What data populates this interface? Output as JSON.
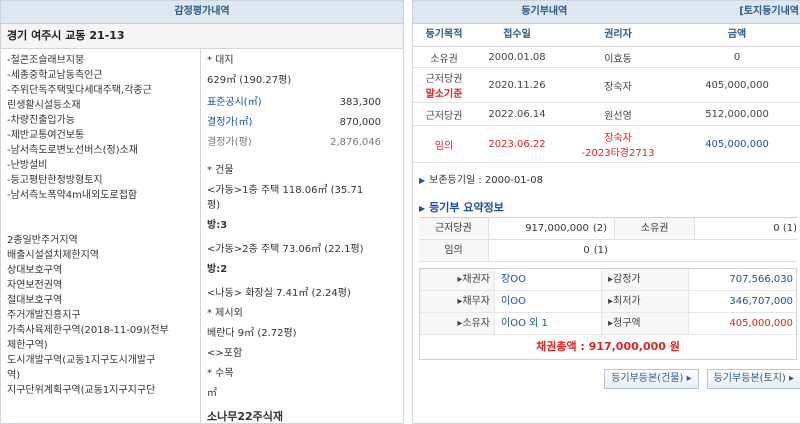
{
  "left": {
    "title": "감정평가내역",
    "address": "경기 여주시 교동 21-13",
    "features": [
      "-철콘조슬래브지붕",
      "-세종중학교남동측인근",
      "-주위단독주택및다세대주택,각종근",
      "린생활시설등소재",
      "-차량진출입가능",
      "-제반교통여건보통",
      "-남서측도로변노선버스(정)소재",
      "-난방설비",
      "-등고평탄한정방형토지",
      "-남서측노폭약4m내외도로접함"
    ],
    "zoning": [
      "2종일반주거지역",
      "배출시설설치제한지역",
      "상대보호구역",
      "자연보전권역",
      "절대보호구역",
      "주거개발진흥지구",
      "가축사육제한구역(2018-11-09)(전부",
      "제한구역)",
      "도시개발구역(교동1지구도시개발구",
      "역)",
      "지구단위계획구역(교동1지구지구단"
    ],
    "land_heading": "* 대지",
    "land_area": "629㎡  (190.27평)",
    "official_price_label": "표준공시(㎡)",
    "official_price_value": "383,300",
    "decided_price_label": "결정가(㎡)",
    "decided_price_value": "870,000",
    "decided_pyeong_label": "결정가(평)",
    "decided_pyeong_value": "2,876,046",
    "building_heading": "* 건물",
    "building1": "<가동>1층 주택 118.06㎡  (35.71",
    "building1b": "평)",
    "building1_rooms": "방:3",
    "building2": "<가동>2층 주택 73.06㎡  (22.1평)",
    "building2_rooms": "방:2",
    "building3": "<나동> 화장실 7.41㎡  (2.24평)",
    "excluded_heading": "* 제시외",
    "veranda": "베란다 9㎡  (2.72평)",
    "included": "<>포함",
    "trees_heading": "* 수목",
    "trees_unit": "㎡",
    "trees_owner": "소나무22주식재"
  },
  "right": {
    "title": "등기부내역",
    "title_tab": "[토지등기내역",
    "headers": [
      "등기목적",
      "접수일",
      "권리자",
      "금액"
    ],
    "rows": [
      {
        "purpose": "소유권",
        "purpose2": "",
        "date": "2000.01.08",
        "holder": "이효동",
        "holder2": "",
        "amount": "0",
        "red": false
      },
      {
        "purpose": "근저당권",
        "purpose2": "말소기준",
        "date": "2020.11.26",
        "holder": "장숙자",
        "holder2": "",
        "amount": "405,000,000",
        "red": false
      },
      {
        "purpose": "근저당권",
        "purpose2": "",
        "date": "2022.06.14",
        "holder": "원선영",
        "holder2": "",
        "amount": "512,000,000",
        "red": false
      },
      {
        "purpose": "임의",
        "purpose2": "",
        "date": "2023.06.22",
        "holder": "장숙자",
        "holder2": "-2023타경2713",
        "amount": "405,000,000",
        "red": true
      }
    ],
    "preserved_date": "보존등기일 : 2000-01-08",
    "summary_title": "등기부 요약정보",
    "summary": [
      {
        "label": "근저당권",
        "value": "917,000,000",
        "count": "(2)",
        "label2": "소유권",
        "value2": "0  (1)"
      },
      {
        "label": "임의",
        "value": "0",
        "count": "(1)",
        "label2": "",
        "value2": ""
      }
    ],
    "parties": [
      {
        "label": "▸채권자",
        "value": "장OO",
        "label2": "▸감정가",
        "value2": "707,566,030",
        "value2_red": false
      },
      {
        "label": "▸채무자",
        "value": "이OO",
        "label2": "▸최저가",
        "value2": "346,707,000",
        "value2_red": false
      },
      {
        "label": "▸소유자",
        "value": "이OO 외 1",
        "label2": "▸청구액",
        "value2": "405,000,000",
        "value2_red": true
      }
    ],
    "total": "채권총액 : 917,000,000 원",
    "btn_building": "등기부등본(건물) ▸",
    "btn_land": "등기부등본(토지) ▸"
  }
}
